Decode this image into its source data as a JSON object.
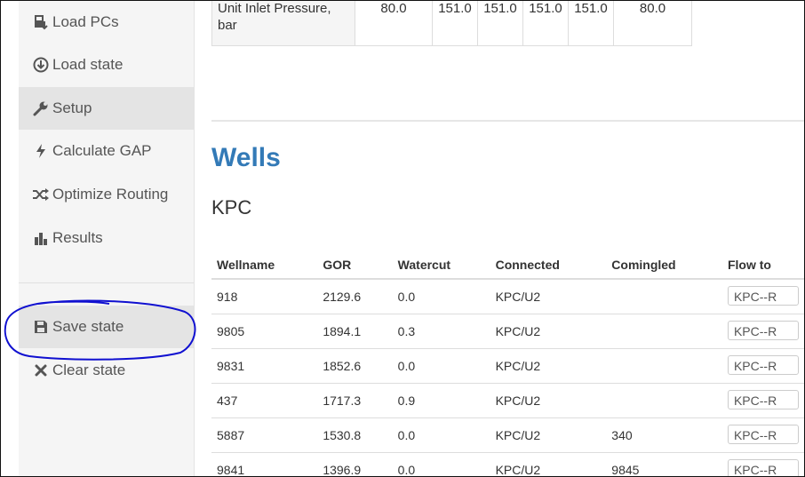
{
  "sidebar": {
    "items": [
      {
        "label": "Load PCs",
        "icon": "file-import-icon"
      },
      {
        "label": "Load state",
        "icon": "download-circle-icon"
      },
      {
        "label": "Setup",
        "icon": "wrench-icon"
      },
      {
        "label": "Calculate GAP",
        "icon": "bolt-icon"
      },
      {
        "label": "Optimize Routing",
        "icon": "shuffle-icon"
      },
      {
        "label": "Results",
        "icon": "bar-chart-icon"
      },
      {
        "label": "Save state",
        "icon": "floppy-disk-icon"
      },
      {
        "label": "Clear state",
        "icon": "x-icon"
      }
    ],
    "active_item": "Setup"
  },
  "top_table": {
    "label": "Unit Inlet Pressure, bar",
    "values": [
      "80.0",
      "151.0",
      "151.0",
      "151.0",
      "151.0",
      "80.0"
    ]
  },
  "wells": {
    "title": "Wells",
    "subtitle": "KPC",
    "columns": [
      "Wellname",
      "GOR",
      "Watercut",
      "Connected",
      "Comingled",
      "Flow to"
    ],
    "rows": [
      {
        "wellname": "918",
        "gor": "2129.6",
        "watercut": "0.0",
        "connected": "KPC/U2",
        "comingled": "",
        "flow_to": "KPC--R"
      },
      {
        "wellname": "9805",
        "gor": "1894.1",
        "watercut": "0.3",
        "connected": "KPC/U2",
        "comingled": "",
        "flow_to": "KPC--R"
      },
      {
        "wellname": "9831",
        "gor": "1852.6",
        "watercut": "0.0",
        "connected": "KPC/U2",
        "comingled": "",
        "flow_to": "KPC--R"
      },
      {
        "wellname": "437",
        "gor": "1717.3",
        "watercut": "0.9",
        "connected": "KPC/U2",
        "comingled": "",
        "flow_to": "KPC--R"
      },
      {
        "wellname": "5887",
        "gor": "1530.8",
        "watercut": "0.0",
        "connected": "KPC/U2",
        "comingled": "340",
        "flow_to": "KPC--R"
      },
      {
        "wellname": "9841",
        "gor": "1396.9",
        "watercut": "0.0",
        "connected": "KPC/U2",
        "comingled": "9845",
        "flow_to": "KPC--R"
      }
    ]
  },
  "colors": {
    "accent": "#337ab7",
    "annotation": "#1010d0",
    "sidebar_bg": "#f5f5f5",
    "active_bg": "#e4e4e4"
  }
}
